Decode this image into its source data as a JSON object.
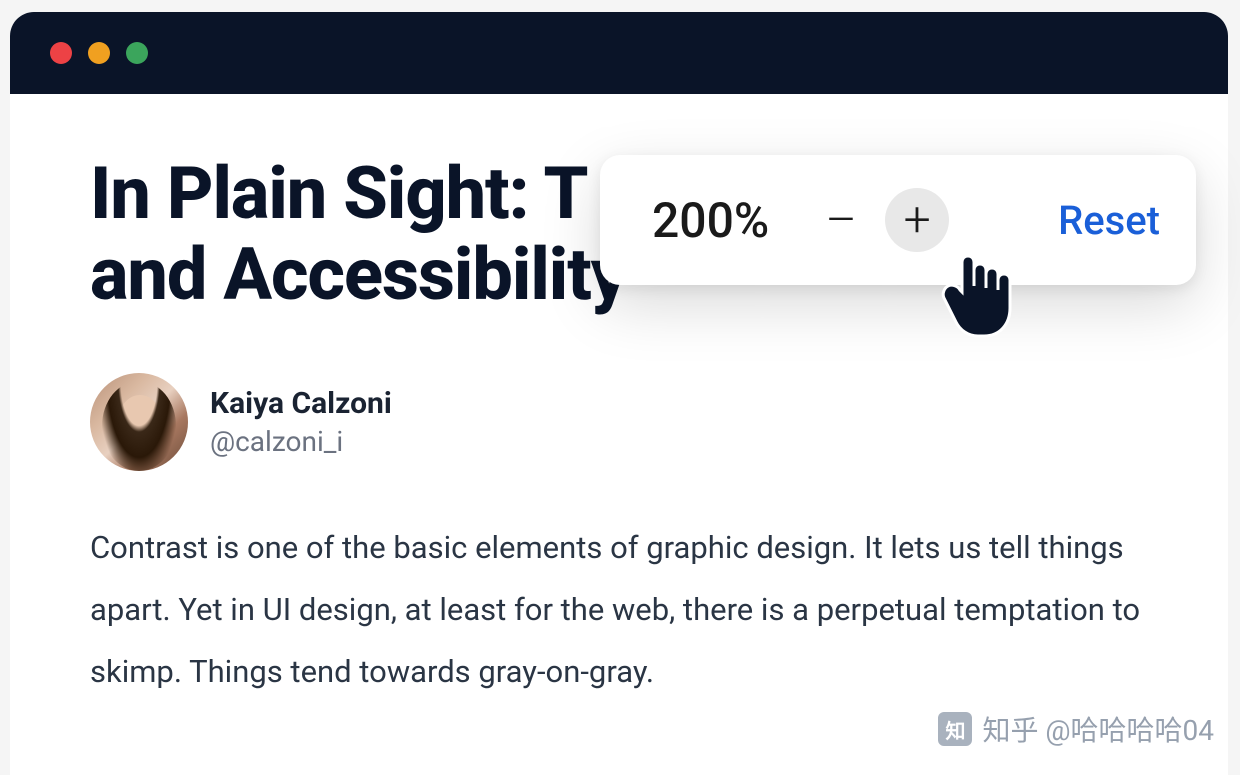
{
  "article": {
    "headline_visible": "In Plain Sight: T\nand Accessibility",
    "author": {
      "name": "Kaiya Calzoni",
      "handle": "@calzoni_i"
    },
    "body": "Contrast is one of the basic elements of graphic design. It lets us tell things apart. Yet in UI design, at least for the web, there is a perpetual temptation to skimp. Things tend towards gray-on-gray."
  },
  "zoom": {
    "value": "200%",
    "minus": "–",
    "plus": "+",
    "reset": "Reset"
  },
  "watermark": {
    "logo": "知",
    "text": "知乎 @哈哈哈哈04"
  }
}
